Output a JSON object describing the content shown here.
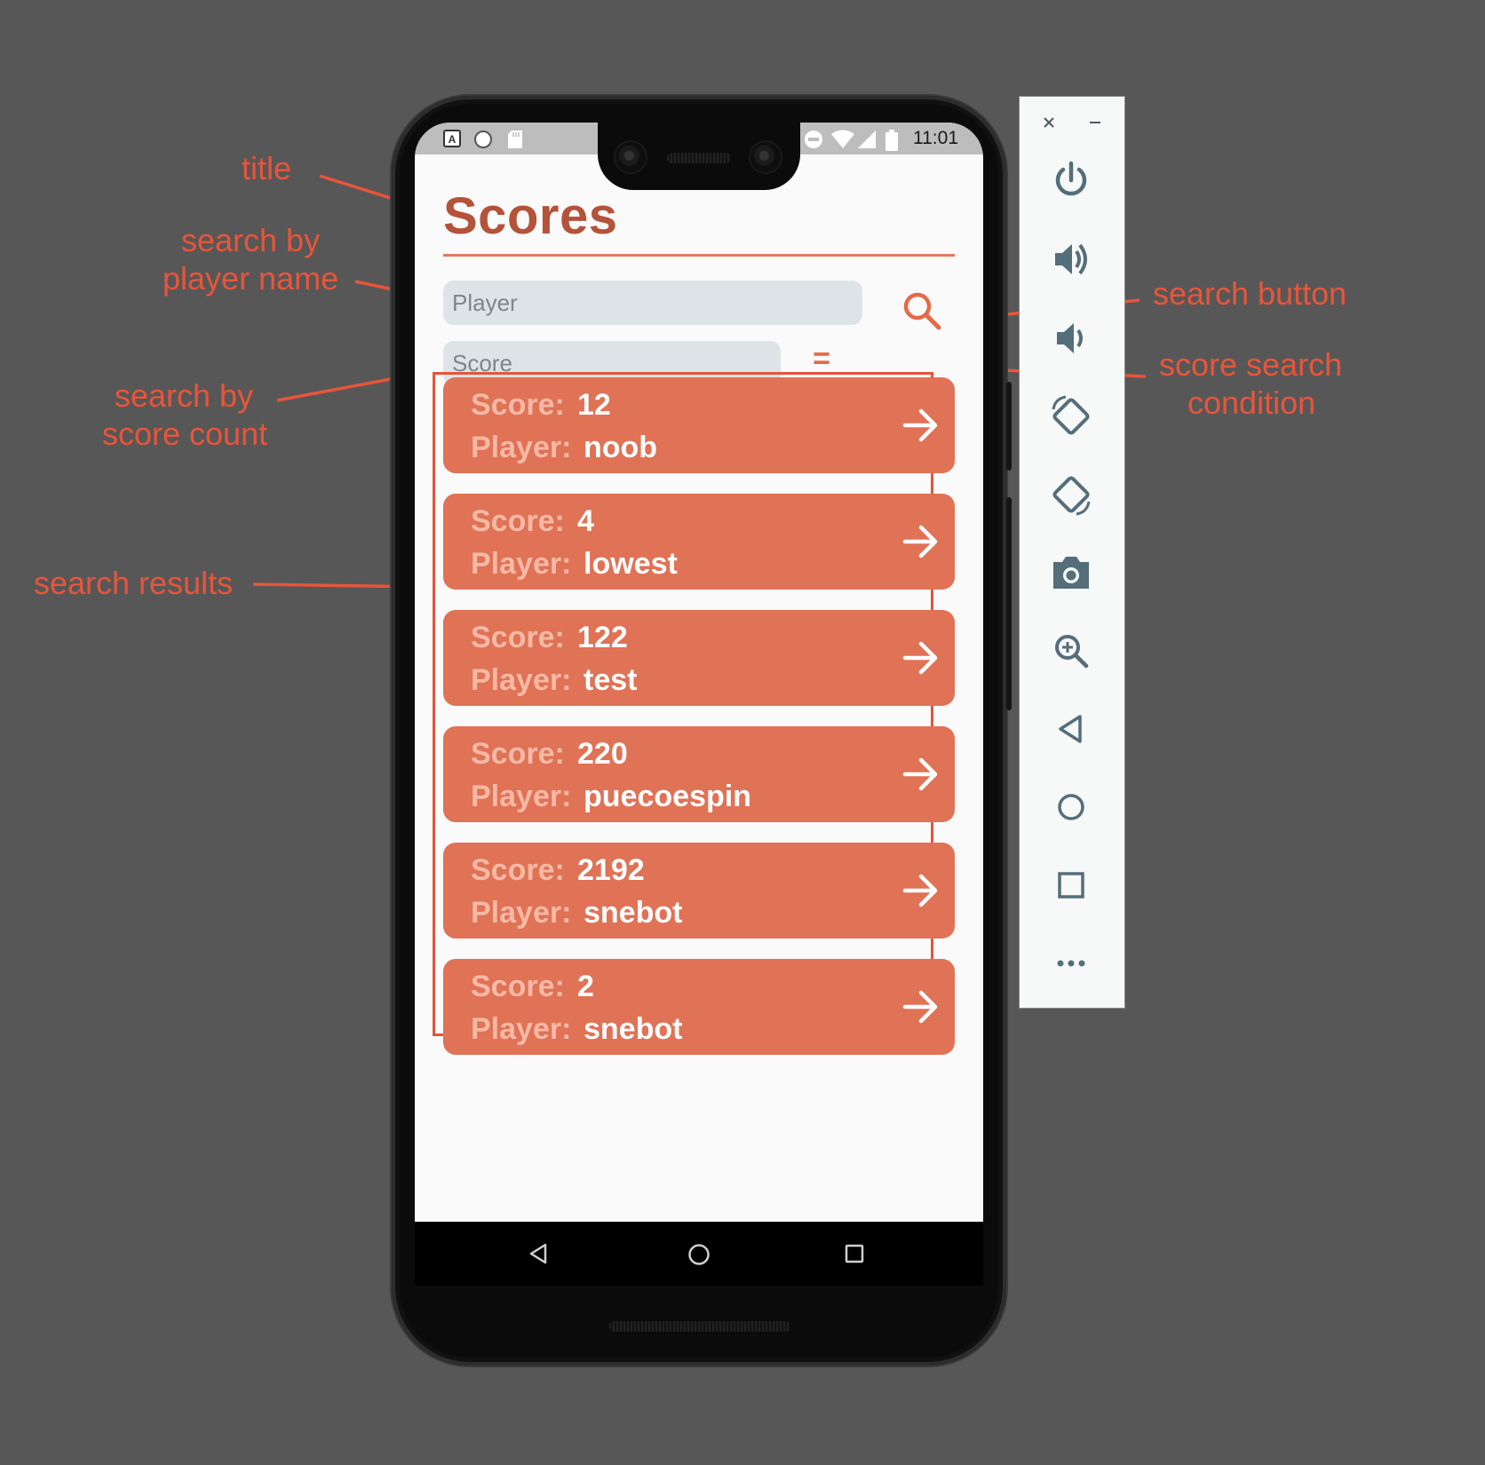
{
  "annotations": {
    "title": "title",
    "search_player_line1": "search by",
    "search_player_line2": "player name",
    "search_score_line1": "search by",
    "search_score_line2": "score count",
    "search_results": "search results",
    "search_button": "search button",
    "score_condition_line1": "score search",
    "score_condition_line2": "condition"
  },
  "status_bar": {
    "time": "11:01",
    "left_icons": [
      "a-icon",
      "circle-icon",
      "sd-card-icon"
    ],
    "right_icons": [
      "do-not-disturb-icon",
      "wifi-icon",
      "signal-icon",
      "battery-icon"
    ]
  },
  "app": {
    "title": "Scores",
    "player_placeholder": "Player",
    "score_placeholder": "Score",
    "condition_symbol": "=",
    "score_label": "Score:",
    "player_label": "Player:",
    "results": [
      {
        "score": "12",
        "player": "noob"
      },
      {
        "score": "4",
        "player": "lowest"
      },
      {
        "score": "122",
        "player": "test"
      },
      {
        "score": "220",
        "player": "puecoespin"
      },
      {
        "score": "2192",
        "player": "snebot"
      },
      {
        "score": "2",
        "player": "snebot"
      }
    ]
  },
  "nav_bar": [
    "back-icon",
    "home-icon",
    "recents-icon"
  ],
  "emulator_panel": {
    "window_controls": [
      "close-icon",
      "minimize-icon"
    ],
    "buttons": [
      "power-icon",
      "volume-up-icon",
      "volume-down-icon",
      "rotate-left-icon",
      "rotate-right-icon",
      "camera-icon",
      "zoom-icon",
      "back-icon",
      "home-icon",
      "overview-icon",
      "more-icon"
    ]
  },
  "colors": {
    "annotation": "#e8553a",
    "card": "#e07256",
    "card_label": "#f6b9a6",
    "title": "#b4523a",
    "background": "#575757"
  }
}
